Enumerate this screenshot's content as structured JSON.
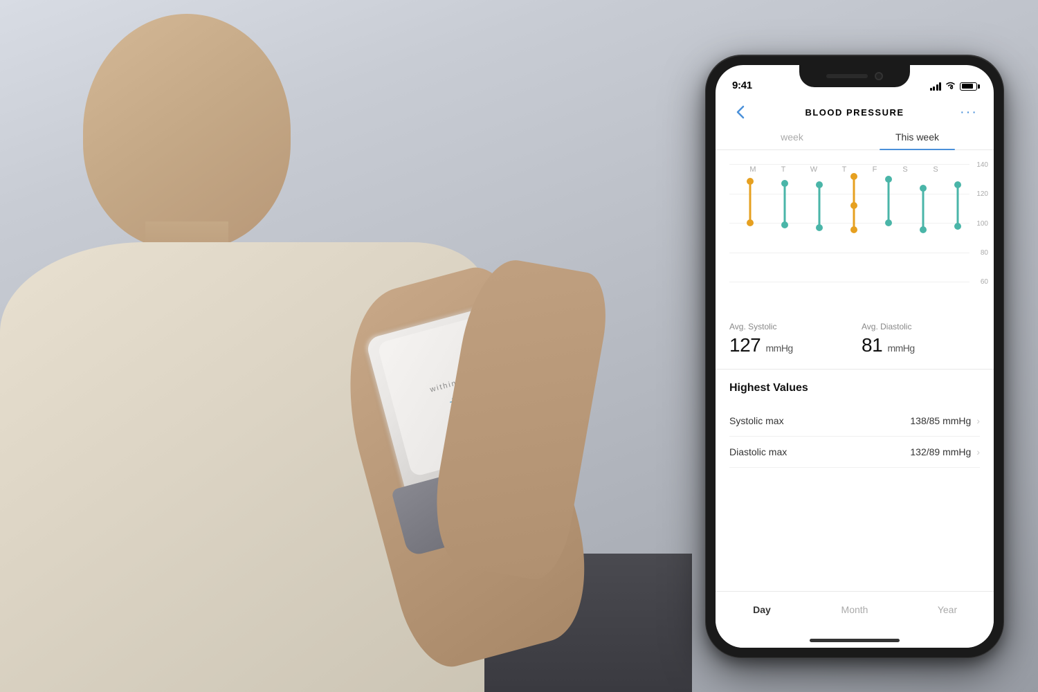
{
  "background": {
    "color": "#b8bcc4"
  },
  "phone": {
    "status_bar": {
      "time": "9:41",
      "signal_label": "signal",
      "wifi_label": "wifi",
      "battery_label": "battery"
    },
    "header": {
      "back_label": "‹",
      "title": "BLOOD PRESSURE",
      "more_label": "···"
    },
    "tabs": {
      "week_label": "week",
      "this_week_label": "This week"
    },
    "chart": {
      "y_labels": [
        "140",
        "120",
        "100",
        "80",
        "60"
      ],
      "x_labels": [
        "M",
        "T",
        "W",
        "T",
        "F",
        "S",
        "S"
      ]
    },
    "stats": {
      "systolic_label": "Avg. Systolic",
      "systolic_value": "127",
      "systolic_unit": "mmHg",
      "diastolic_label": "Avg. Diastolic",
      "diastolic_value": "81",
      "diastolic_unit": "mmHg"
    },
    "highest_values": {
      "section_title": "Highest Values",
      "systolic_label": "Systolic max",
      "systolic_value": "138/85 mmHg",
      "diastolic_label": "Diastolic max",
      "diastolic_value": "132/89 mmHg"
    },
    "bottom_tabs": {
      "day_label": "Day",
      "month_label": "Month",
      "year_label": "Year"
    }
  },
  "device": {
    "brand": "withings",
    "plus_symbol": "+"
  },
  "colors": {
    "accent_blue": "#4a90d9",
    "chart_gold": "#e6a020",
    "chart_teal": "#4ab5a8",
    "tab_active_underline": "#4a90d9"
  }
}
